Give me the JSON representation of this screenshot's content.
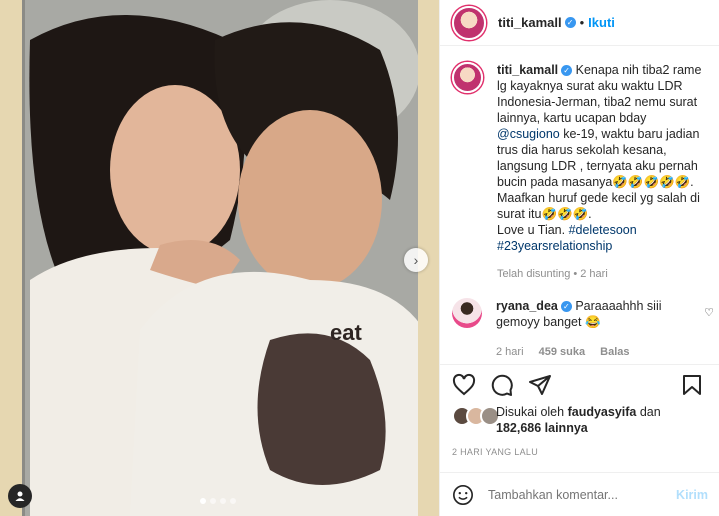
{
  "post": {
    "username": "titi_kamall",
    "follow_label": "Ikuti",
    "separator": "•",
    "caption_lines": [
      "Kenapa nih tiba2 rame",
      "lg kayaknya surat aku waktu LDR",
      "Indonesia-Jerman, tiba2 nemu surat",
      "lainnya, kartu ucapan bday"
    ],
    "caption_mention": "@csugiono",
    "caption_lines_2": [
      " ke-19, waktu baru jadian",
      "trus dia harus sekolah kesana,",
      "langsung LDR , ternyata aku pernah",
      "bucin pada masanya🤣🤣🤣🤣🤣.",
      "Maafkan huruf gede kecil yg salah di",
      "surat itu🤣🤣🤣.",
      "Love u Tian. "
    ],
    "caption_tag_1": "#deletesoon",
    "caption_tag_2": "#23yearsrelationship",
    "edited_label": "Telah disunting",
    "edited_time": "2 hari"
  },
  "comment": {
    "username": "ryana_dea",
    "text_line_1": "Paraaaahhh siii",
    "text_line_2": "gemoyy banget 😂",
    "time": "2 hari",
    "likes": "459 suka",
    "reply_label": "Balas"
  },
  "likes_summary": {
    "prefix": "Disukai oleh ",
    "user": "faudyasyifa",
    "middle": " dan",
    "count": "182,686 lainnya"
  },
  "date_label": "2 HARI YANG LALU",
  "add_comment": {
    "placeholder": "Tambahkan komentar...",
    "post_label": "Kirim"
  },
  "colors": {
    "accent": "#0095f6",
    "verified": "#3897f0",
    "muted": "#8e8e8e"
  },
  "carousel": {
    "total": 4,
    "current": 1
  }
}
